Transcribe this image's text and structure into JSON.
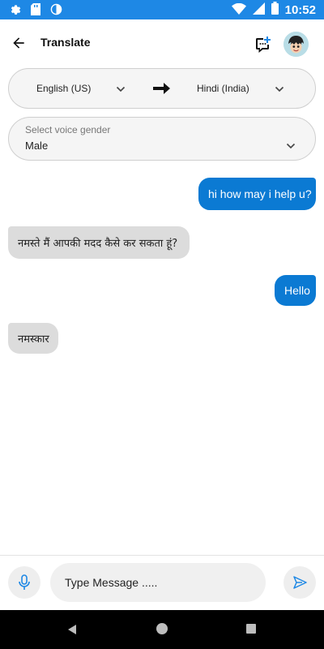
{
  "status_bar": {
    "time": "10:52",
    "icons": [
      "settings-icon",
      "sd-card-icon",
      "circle-icon",
      "wifi-icon",
      "signal-icon",
      "battery-icon"
    ]
  },
  "app_bar": {
    "title": "Translate",
    "icons": [
      "back-arrow-icon",
      "chat-plus-icon",
      "avatar"
    ]
  },
  "language_selector": {
    "from": "English (US)",
    "to": "Hindi (India)",
    "arrow_icon": "arrow-right-icon"
  },
  "voice_selector": {
    "label": "Select voice gender",
    "value": "Male"
  },
  "messages": [
    {
      "direction": "outgoing",
      "text": "hi how may i help u?"
    },
    {
      "direction": "incoming",
      "text": "नमस्ते मैं आपकी मदद कैसे कर सकता हूं?"
    },
    {
      "direction": "outgoing",
      "text": "Hello"
    },
    {
      "direction": "incoming",
      "text": "नमस्कार"
    }
  ],
  "composer": {
    "placeholder": "Type Message .....",
    "value": "",
    "mic_icon": "mic-icon",
    "send_icon": "send-icon"
  },
  "colors": {
    "status_bar": "#1e88e5",
    "outgoing_bubble": "#0b7ad3",
    "incoming_bubble": "#dcdcdc",
    "accent": "#1e88e5"
  }
}
